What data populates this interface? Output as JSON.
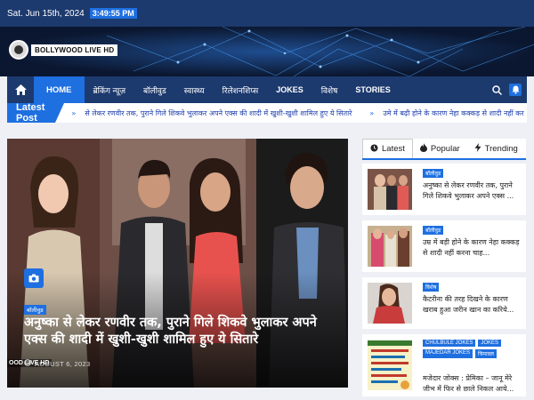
{
  "topbar": {
    "date": "Sat. Jun 15th, 2024",
    "time": "3:49:55 PM"
  },
  "logo": {
    "text": "BOLLYWOOD LIVE HD"
  },
  "nav": {
    "items": [
      {
        "label": "HOME"
      },
      {
        "label": "ब्रेकिंग न्यूज़"
      },
      {
        "label": "बॉलीवुड"
      },
      {
        "label": "स्वास्थ्य"
      },
      {
        "label": "रिलेशनशिप्स"
      },
      {
        "label": "JOKES"
      },
      {
        "label": "विशेष"
      },
      {
        "label": "STORIES"
      }
    ],
    "icons": [
      "home-icon",
      "search-icon",
      "bell-icon"
    ]
  },
  "ticker": {
    "label": "Latest Post",
    "items": [
      "से लेकर रणवीर तक, पुराने गिले शिकवे भुलाकर अपने एक्स की शादी में खुशी-खुशी शामिल हुए ये सितारे",
      "उमे में बढ़ी होने के कारण नेहा कक्कड़ से शादी नहीं कर"
    ]
  },
  "hero": {
    "category": "बॉलीवुड",
    "title": "अनुष्का से लेकर रणवीर तक, पुराने गिले शिकवे भुलाकर अपने एक्स की शादी में खुशी-खुशी शामिल हुए ये सितारे",
    "date": "AUGUST 6, 2023",
    "watermark": "OOD LIVE HD"
  },
  "sidebar": {
    "tabs": [
      {
        "label": "Latest",
        "icon": "clock-icon"
      },
      {
        "label": "Popular",
        "icon": "fire-icon"
      },
      {
        "label": "Trending",
        "icon": "bolt-icon"
      }
    ],
    "posts": [
      {
        "categories": [
          "बॉलीवुड"
        ],
        "title": "अनुष्का से लेकर रणवीर तक, पुराने गिले शिकवे भुलाकर अपने एक्स ..."
      },
      {
        "categories": [
          "बॉलीवुड"
        ],
        "title": "उम्र में बड़ी होने के कारण नेहा कक्कड़ से शादी नहीं करना चाह..."
      },
      {
        "categories": [
          "विशेष"
        ],
        "title": "कैटरीना की तरह दिखने के कारण खराब हुआ जरीन खान का करिये..."
      },
      {
        "categories": [
          "CHULBULE JOKES",
          "JOKES",
          "MAJEDAR JOKES",
          "चिमावल"
        ],
        "title": "मजेदार जोक्स : प्रेमिका – जानू मेरे जीभ में फिर से छाले निकल आये..."
      }
    ]
  }
}
